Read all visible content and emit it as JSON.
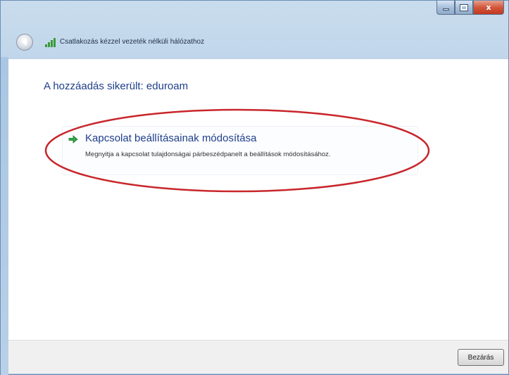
{
  "window": {
    "title": "Csatlakozás kézzel vezeték nélküli hálózathoz",
    "controls": {
      "minimize_icon": "minimize-icon",
      "maximize_icon": "maximize-icon",
      "close_label": "x"
    }
  },
  "content": {
    "heading": "A hozzáadás sikerült: eduroam",
    "link": {
      "title": "Kapcsolat beállításainak módosítása",
      "description": "Megnyitja a kapcsolat tulajdonságai párbeszédpanelt a beállítások módosításához.",
      "icon": "green-arrow-icon"
    }
  },
  "footer": {
    "close_button_label": "Bezárás"
  },
  "colors": {
    "heading": "#1f3f8a",
    "annotation": "#c8262b",
    "arrow": "#2da846",
    "close_button_chrome": "#c0391f"
  }
}
